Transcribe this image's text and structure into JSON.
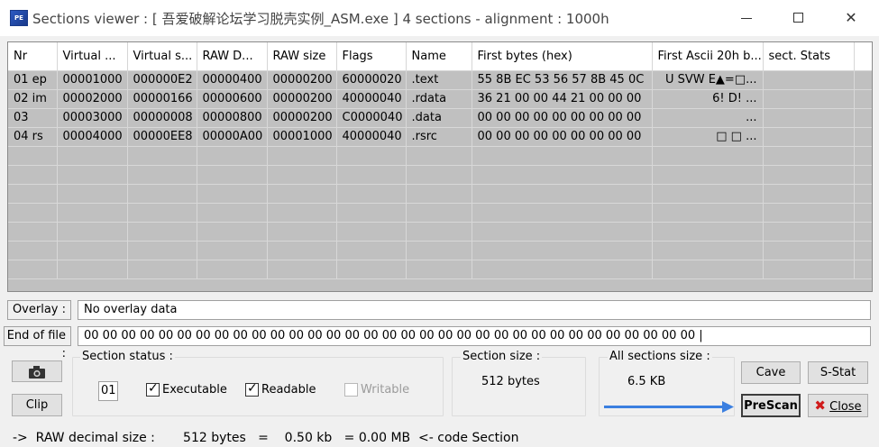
{
  "window": {
    "title": "Sections viewer : [ 吾爱破解论坛学习脱壳实例_ASM.exe ] 4 sections - alignment : 1000h",
    "icon_name": "app-icon",
    "minimize_label": "",
    "maximize_label": "",
    "close_glyph": "✕"
  },
  "table": {
    "columns": [
      "Nr",
      "Virtual ...",
      "Virtual s...",
      "RAW D...",
      "RAW size",
      "Flags",
      "Name",
      "First bytes (hex)",
      "First Ascii 20h b...",
      "sect. Stats"
    ],
    "rows": [
      [
        "01 ep",
        "00001000",
        "000000E2",
        "00000400",
        "00000200",
        "60000020",
        ".text",
        "55 8B EC 53 56 57 8B 45 0C",
        "U  SVW E▲=□...",
        ""
      ],
      [
        "02 im",
        "00002000",
        "00000166",
        "00000600",
        "00000200",
        "40000040",
        ".rdata",
        "36 21 00 00 44 21 00 00 00",
        "6!  D!         ...",
        ""
      ],
      [
        "03",
        "00003000",
        "00000008",
        "00000800",
        "00000200",
        "C0000040",
        ".data",
        "00 00 00 00 00 00 00 00 00",
        "...",
        ""
      ],
      [
        "04 rs",
        "00004000",
        "00000EE8",
        "00000A00",
        "00001000",
        "40000040",
        ".rsrc",
        "00 00 00 00 00 00 00 00 00",
        "□ □ ...",
        ""
      ]
    ]
  },
  "overlay": {
    "label": "Overlay :",
    "value": "No overlay data"
  },
  "end_of_file": {
    "label": "End of file :",
    "value": "00 00 00 00 00 00 00 00 00 00 00 00 00 00 00 00 00 00 00 00 00 00 00 00 00 00 00 00 00 00 00 00 00    |"
  },
  "buttons": {
    "camera_icon": "camera-icon",
    "clip": "Clip",
    "cave": "Cave",
    "s_stat": "S-Stat",
    "prescan": "PreScan",
    "close": "Close",
    "close_icon_glyph": "✖"
  },
  "section_status": {
    "title": "Section status :",
    "number": "01",
    "executable_label": "Executable",
    "executable_checked": true,
    "readable_label": "Readable",
    "readable_checked": true,
    "writable_label": "Writable",
    "writable_checked": false
  },
  "section_size": {
    "title": "Section size :",
    "value": "512 bytes"
  },
  "all_sections_size": {
    "title": "All sections size :",
    "value": "6.5 KB"
  },
  "status_bar": {
    "text": "->  RAW decimal size :       512 bytes   =    0.50 kb   = 0.00 MB  <- code Section"
  },
  "colors": {
    "grid_bg": "#c0c0c0",
    "arrow": "#3b7fe0",
    "close_icon": "#d01b1b"
  }
}
